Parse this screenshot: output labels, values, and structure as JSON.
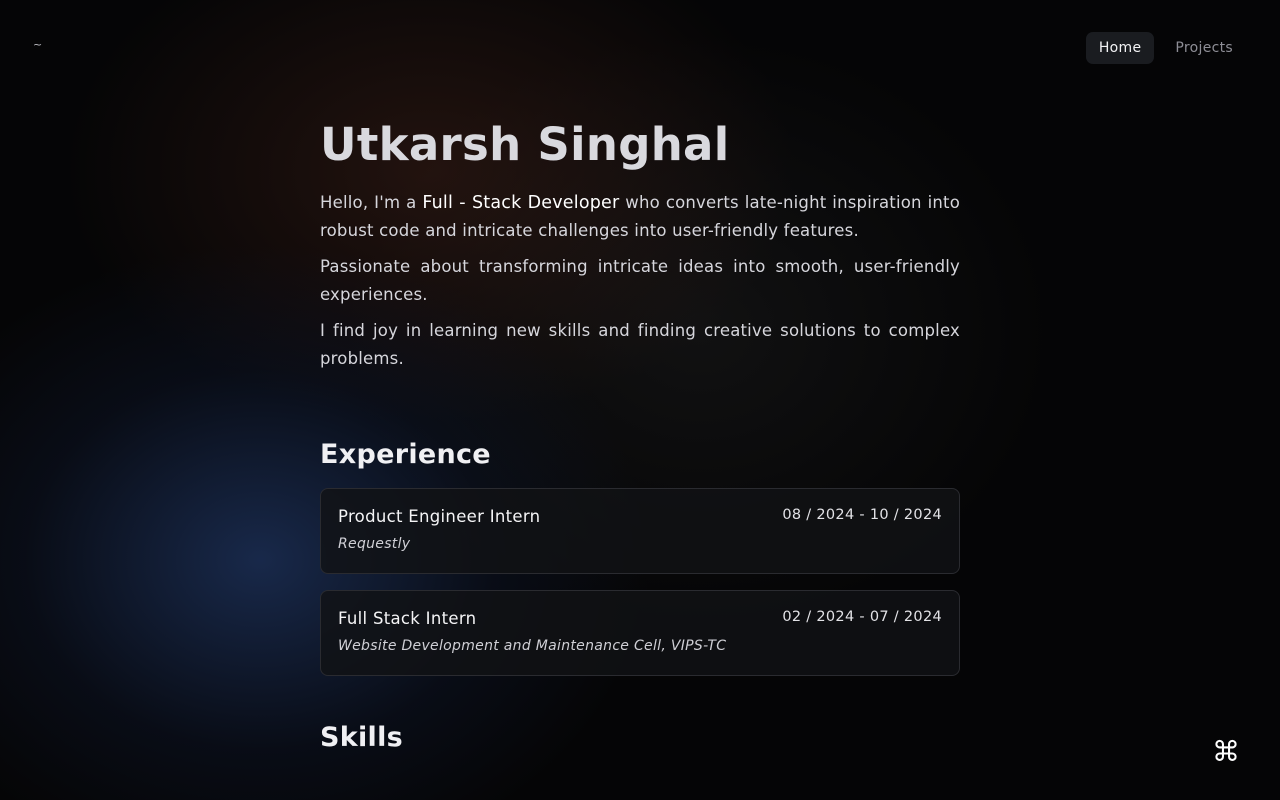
{
  "header": {
    "logo_text": "~",
    "nav": [
      {
        "label": "Home",
        "active": true
      },
      {
        "label": "Projects",
        "active": false
      }
    ]
  },
  "hero": {
    "name": "Utkarsh Singhal",
    "intro_prefix": "Hello, I'm a ",
    "intro_highlight": "Full - Stack Developer",
    "intro_suffix": " who converts late-night inspiration into robust code and intricate challenges into user-friendly features.",
    "para2": "Passionate about transforming intricate ideas into smooth, user-friendly experiences.",
    "para3": "I find joy in learning new skills and finding creative solutions to complex problems."
  },
  "experience": {
    "title": "Experience",
    "items": [
      {
        "role": "Product Engineer Intern",
        "company": "Requestly",
        "dates": "08 / 2024 - 10 / 2024"
      },
      {
        "role": "Full Stack Intern",
        "company": "Website Development and Maintenance Cell, VIPS-TC",
        "dates": "02 / 2024 - 07 / 2024"
      }
    ]
  },
  "skills": {
    "title": "Skills"
  },
  "command_button": {
    "icon": "command-icon",
    "glyph": "⌘"
  }
}
